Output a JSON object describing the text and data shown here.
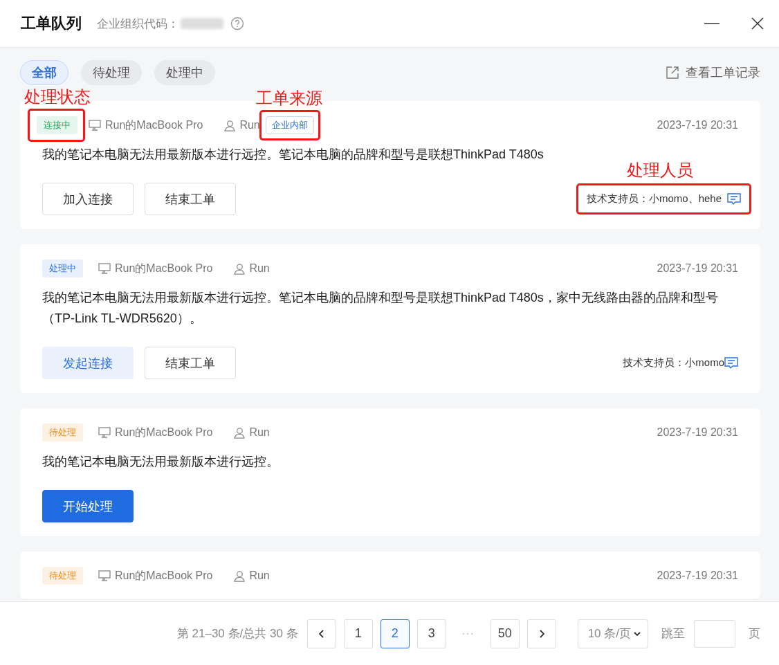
{
  "window": {
    "title": "工单队列",
    "org_code_label": "企业组织代码："
  },
  "tabs": [
    {
      "label": "全部",
      "selected": true
    },
    {
      "label": "待处理",
      "selected": false
    },
    {
      "label": "处理中",
      "selected": false
    }
  ],
  "records_link": "查看工单记录",
  "tickets": [
    {
      "status": {
        "label": "连接中",
        "kind": "connecting"
      },
      "device": "Run的MacBook Pro",
      "user": "Run",
      "source": "企业内部",
      "time": "2023-7-19 20:31",
      "description": "我的笔记本电脑无法用最新版本进行远控。笔记本电脑的品牌和型号是联想ThinkPad T480s",
      "buttons": [
        {
          "label": "加入连接",
          "kind": "default"
        },
        {
          "label": "结束工单",
          "kind": "default"
        }
      ],
      "staff": "技术支持员：小momo、hehe",
      "annotations": {
        "status": "处理状态",
        "source": "工单来源",
        "staff": "处理人员"
      }
    },
    {
      "status": {
        "label": "处理中",
        "kind": "processing"
      },
      "device": "Run的MacBook Pro",
      "user": "Run",
      "time": "2023-7-19 20:31",
      "description": "我的笔记本电脑无法用最新版本进行远控。笔记本电脑的品牌和型号是联想ThinkPad T480s，家中无线路由器的品牌和型号（TP-Link TL-WDR5620）。",
      "buttons": [
        {
          "label": "发起连接",
          "kind": "light"
        },
        {
          "label": "结束工单",
          "kind": "default"
        }
      ],
      "staff": "技术支持员：小momo"
    },
    {
      "status": {
        "label": "待处理",
        "kind": "pending"
      },
      "device": "Run的MacBook Pro",
      "user": "Run",
      "time": "2023-7-19 20:31",
      "description": "我的笔记本电脑无法用最新版本进行远控。",
      "buttons": [
        {
          "label": "开始处理",
          "kind": "primary"
        }
      ]
    },
    {
      "status": {
        "label": "待处理",
        "kind": "pending"
      },
      "device": "Run的MacBook Pro",
      "user": "Run",
      "time": "2023-7-19 20:31"
    }
  ],
  "pagination": {
    "summary": "第 21–30 条/总共 30 条",
    "pages": [
      {
        "label": "1",
        "selected": false
      },
      {
        "label": "2",
        "selected": true
      },
      {
        "label": "3",
        "selected": false
      },
      {
        "label": "50",
        "selected": false
      }
    ],
    "ellipsis": "···",
    "page_size": "10 条/页",
    "jump_label": "跳至",
    "jump_suffix": "页"
  }
}
